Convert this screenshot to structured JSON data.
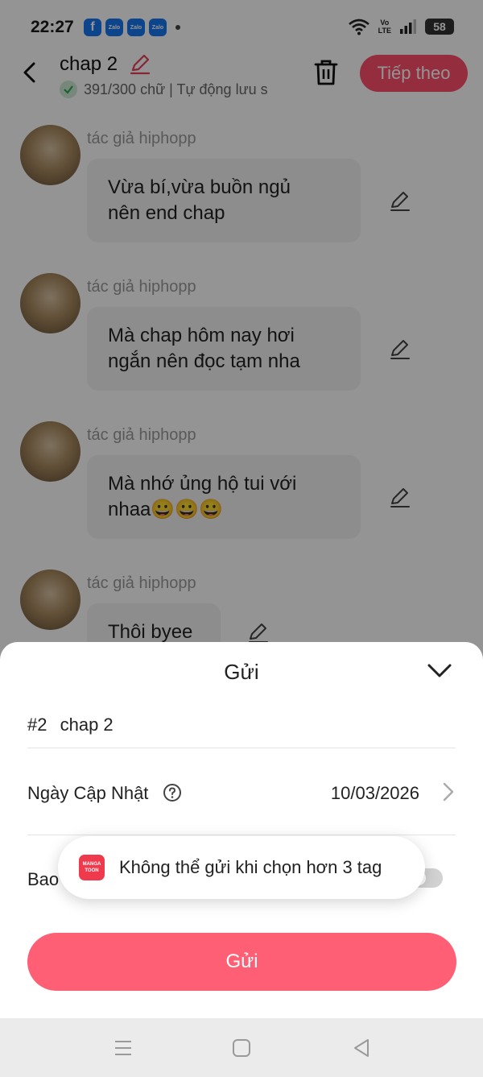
{
  "status_bar": {
    "time": "22:27",
    "notif_icons": [
      "facebook-icon",
      "zalo-icon",
      "zalo-icon",
      "zalo-icon"
    ],
    "zalo_label": "Zalo",
    "volte_top": "Vo",
    "volte_bottom": "LTE",
    "battery": "58"
  },
  "header": {
    "title": "chap 2",
    "meta": "391/300 chữ | Tự động lưu s",
    "next_label": "Tiếp theo"
  },
  "messages": [
    {
      "author": "tác giả hiphopp",
      "text_lines": [
        "Vừa bí,vừa buồn ngủ",
        "nên end chap"
      ]
    },
    {
      "author": "tác giả hiphopp",
      "text_lines": [
        "Mà chap hôm nay hơi",
        "ngắn nên đọc tạm nha"
      ]
    },
    {
      "author": "tác giả hiphopp",
      "text_lines": [
        "Mà nhớ ủng hộ tui với",
        "nhaa😀😀😀"
      ]
    },
    {
      "author": "tác giả hiphopp",
      "text_lines": [
        "Thôi byee"
      ]
    }
  ],
  "sheet": {
    "title": "Gửi",
    "chapter_number": "#2",
    "chapter_name": "chap 2",
    "update_label": "Ngày Cập Nhật",
    "update_value": "10/03/2026",
    "third_row_label": "Bao",
    "send_label": "Gửi"
  },
  "toast": {
    "logo_line1": "MANGA",
    "logo_line2": "TOON",
    "message": "Không thể gửi khi chọn hơn 3 tag"
  },
  "colors": {
    "accent": "#ff5f74",
    "toast_logo": "#ef3a4e"
  }
}
